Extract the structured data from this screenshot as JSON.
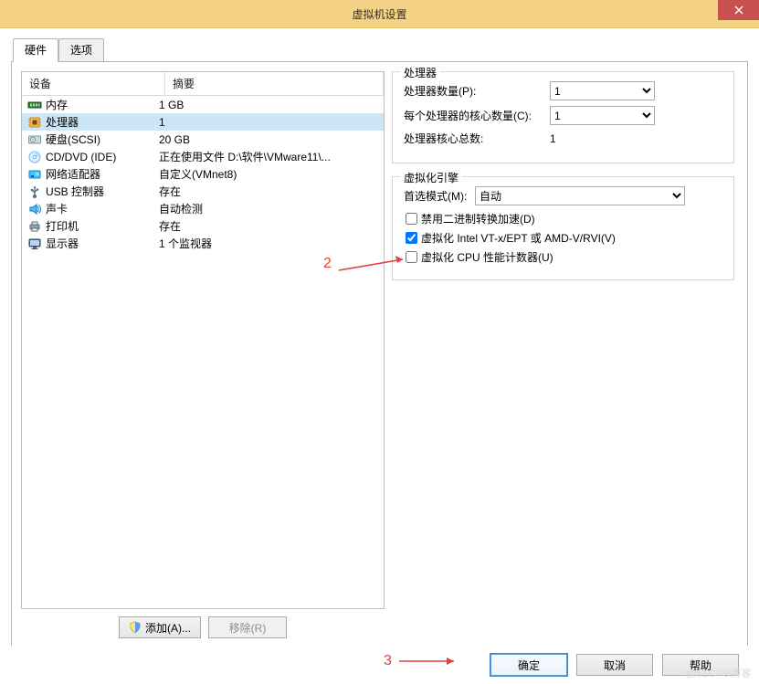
{
  "window": {
    "title": "虚拟机设置"
  },
  "tabs": {
    "hardware": "硬件",
    "options": "选项"
  },
  "list": {
    "header": {
      "device": "设备",
      "summary": "摘要"
    },
    "rows": [
      {
        "name": "内存",
        "summary": "1 GB",
        "icon": "memory"
      },
      {
        "name": "处理器",
        "summary": "1",
        "icon": "cpu",
        "selected": true
      },
      {
        "name": "硬盘(SCSI)",
        "summary": "20 GB",
        "icon": "hdd"
      },
      {
        "name": "CD/DVD (IDE)",
        "summary": "正在使用文件 D:\\软件\\VMware11\\...",
        "icon": "cd"
      },
      {
        "name": "网络适配器",
        "summary": "自定义(VMnet8)",
        "icon": "nic"
      },
      {
        "name": "USB 控制器",
        "summary": "存在",
        "icon": "usb"
      },
      {
        "name": "声卡",
        "summary": "自动检测",
        "icon": "sound"
      },
      {
        "name": "打印机",
        "summary": "存在",
        "icon": "printer"
      },
      {
        "name": "显示器",
        "summary": "1 个监视器",
        "icon": "display"
      }
    ],
    "add_label": "添加(A)...",
    "remove_label": "移除(R)"
  },
  "processor_group": {
    "legend": "处理器",
    "procs_label": "处理器数量(P):",
    "procs_value": "1",
    "cores_label": "每个处理器的核心数量(C):",
    "cores_value": "1",
    "total_label": "处理器核心总数:",
    "total_value": "1"
  },
  "virt_group": {
    "legend": "虚拟化引擎",
    "mode_label": "首选模式(M):",
    "mode_value": "自动",
    "cb_disable_bt": "禁用二进制转换加速(D)",
    "cb_vt_ept": "虚拟化 Intel VT-x/EPT 或 AMD-V/RVI(V)",
    "cb_cpu_perf": "虚拟化 CPU 性能计数器(U)"
  },
  "footer": {
    "ok": "确定",
    "cancel": "取消",
    "help": "帮助"
  },
  "annotations": {
    "arrow2": "2",
    "arrow3": "3"
  },
  "watermark": "@51CTO博客"
}
